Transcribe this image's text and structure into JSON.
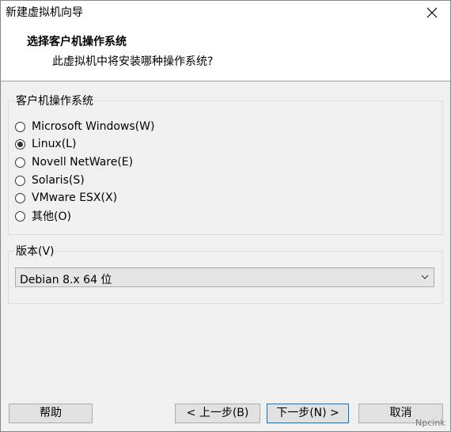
{
  "window": {
    "title": "新建虚拟机向导"
  },
  "header": {
    "title": "选择客户机操作系统",
    "subtitle": "此虚拟机中将安装哪种操作系统?"
  },
  "guest_os_group": {
    "label": "客户机操作系统",
    "options": [
      {
        "label": "Microsoft Windows(W)",
        "checked": false
      },
      {
        "label": "Linux(L)",
        "checked": true
      },
      {
        "label": "Novell NetWare(E)",
        "checked": false
      },
      {
        "label": "Solaris(S)",
        "checked": false
      },
      {
        "label": "VMware ESX(X)",
        "checked": false
      },
      {
        "label": "其他(O)",
        "checked": false
      }
    ]
  },
  "version_group": {
    "label": "版本(V)",
    "selected": "Debian 8.x 64 位"
  },
  "buttons": {
    "help": "帮助",
    "back": "< 上一步(B)",
    "next": "下一步(N) >",
    "cancel": "取消"
  },
  "watermark": "Npcink",
  "icons": {
    "close": "close-icon",
    "dropdown": "chevron-down-icon"
  },
  "colors": {
    "focus_border": "#0078d7"
  }
}
